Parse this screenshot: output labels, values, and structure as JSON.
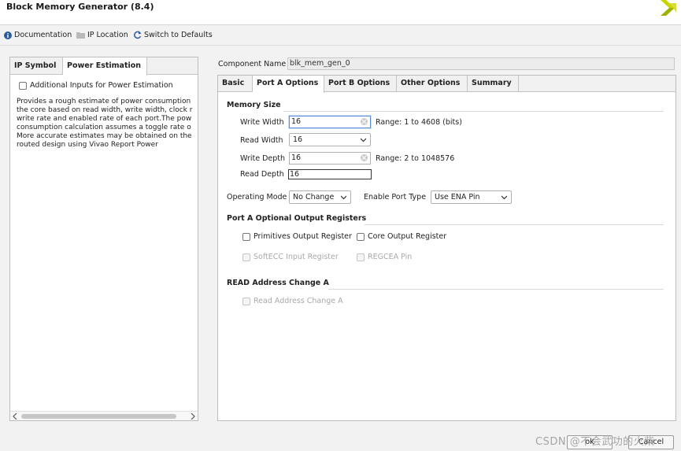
{
  "window": {
    "title": "Block Memory Generator (8.4)",
    "logo_icon": "xilinx-logo-icon"
  },
  "toolbar": {
    "documentation": "Documentation",
    "ip_location": "IP Location",
    "switch_defaults": "Switch to Defaults"
  },
  "left_panel": {
    "tabs": [
      "IP Symbol",
      "Power Estimation"
    ],
    "active_tab": "Power Estimation",
    "checkbox_label": "Additional Inputs for Power Estimation",
    "description": "Provides a rough estimate of power consumption\nthe core based on read width, write width, clock r\nwrite rate and enabled rate of each port.The pow\nconsumption calculation assumes a toggle rate o\nMore accurate estimates may be obtained on the\nrouted design using Vivao Report Power"
  },
  "component": {
    "label": "Component Name",
    "value": "blk_mem_gen_0"
  },
  "right_tabs": [
    "Basic",
    "Port A Options",
    "Port B Options",
    "Other Options",
    "Summary"
  ],
  "active_right_tab": "Port A Options",
  "memory_size": {
    "heading": "Memory Size",
    "write_width_label": "Write Width",
    "write_width_value": "16",
    "write_width_range": "Range: 1 to 4608 (bits)",
    "read_width_label": "Read Width",
    "read_width_value": "16",
    "write_depth_label": "Write Depth",
    "write_depth_value": "16",
    "write_depth_range": "Range: 2 to 1048576",
    "read_depth_label": "Read Depth",
    "read_depth_value": "16"
  },
  "modes": {
    "operating_mode_label": "Operating Mode",
    "operating_mode_value": "No Change",
    "enable_port_type_label": "Enable Port Type",
    "enable_port_type_value": "Use ENA Pin"
  },
  "optional_regs": {
    "heading": "Port A Optional Output Registers",
    "primitives": "Primitives Output Register",
    "core": "Core Output Register",
    "softecc": "SoftECC Input Register",
    "regcea": "REGCEA Pin"
  },
  "read_addr": {
    "heading": "READ Address Change A",
    "checkbox": "Read Address Change A"
  },
  "footer": {
    "ok": "ok",
    "cancel": "Cancel"
  },
  "watermark": "CSDN @不会武功的火柴",
  "colors": {
    "focus_border": "#5a8fd6",
    "logo_yellow": "#c9d400"
  }
}
